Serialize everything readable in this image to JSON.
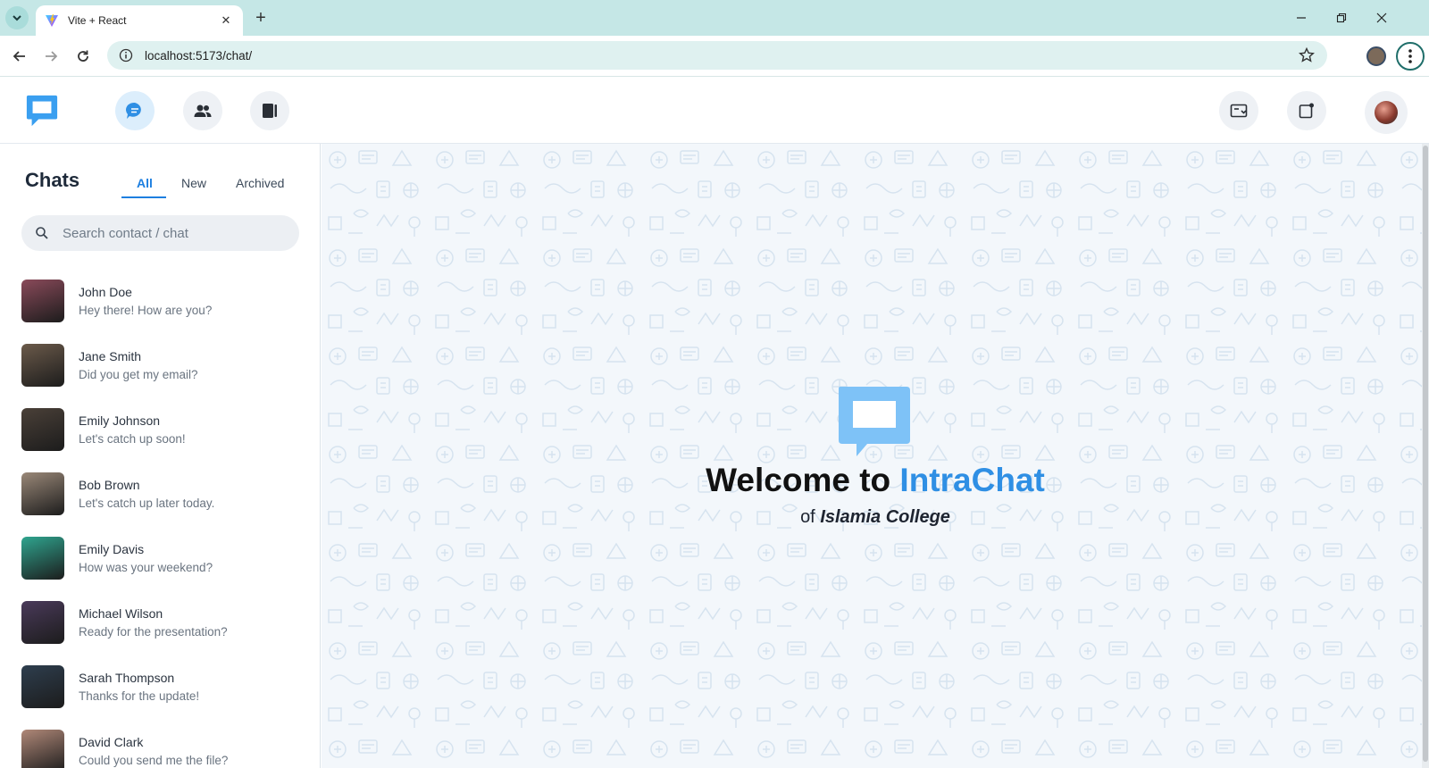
{
  "browser": {
    "tab_title": "Vite + React",
    "url": "localhost:5173/chat/"
  },
  "sidebar": {
    "title": "Chats",
    "tabs": [
      {
        "label": "All",
        "active": true
      },
      {
        "label": "New",
        "active": false
      },
      {
        "label": "Archived",
        "active": false
      }
    ],
    "search_placeholder": "Search contact / chat",
    "chats": [
      {
        "name": "John Doe",
        "message": "Hey there! How are you?",
        "avatar_color": "#8a4a5a"
      },
      {
        "name": "Jane Smith",
        "message": "Did you get my email?",
        "avatar_color": "#6b5a4a"
      },
      {
        "name": "Emily Johnson",
        "message": "Let's catch up soon!",
        "avatar_color": "#4a4038"
      },
      {
        "name": "Bob Brown",
        "message": "Let's catch up later today.",
        "avatar_color": "#9a8878"
      },
      {
        "name": "Emily Davis",
        "message": "How was your weekend?",
        "avatar_color": "#2fa58f"
      },
      {
        "name": "Michael Wilson",
        "message": "Ready for the presentation?",
        "avatar_color": "#4a3a5a"
      },
      {
        "name": "Sarah Thompson",
        "message": "Thanks for the update!",
        "avatar_color": "#2e3e4e"
      },
      {
        "name": "David Clark",
        "message": "Could you send me the file?",
        "avatar_color": "#b08878"
      }
    ]
  },
  "welcome": {
    "prefix": "Welcome to ",
    "brand": "IntraChat",
    "sub_prefix": "of ",
    "college": "Islamia College"
  },
  "colors": {
    "accent": "#2f8fe4",
    "logo": "#4aa8f0"
  }
}
